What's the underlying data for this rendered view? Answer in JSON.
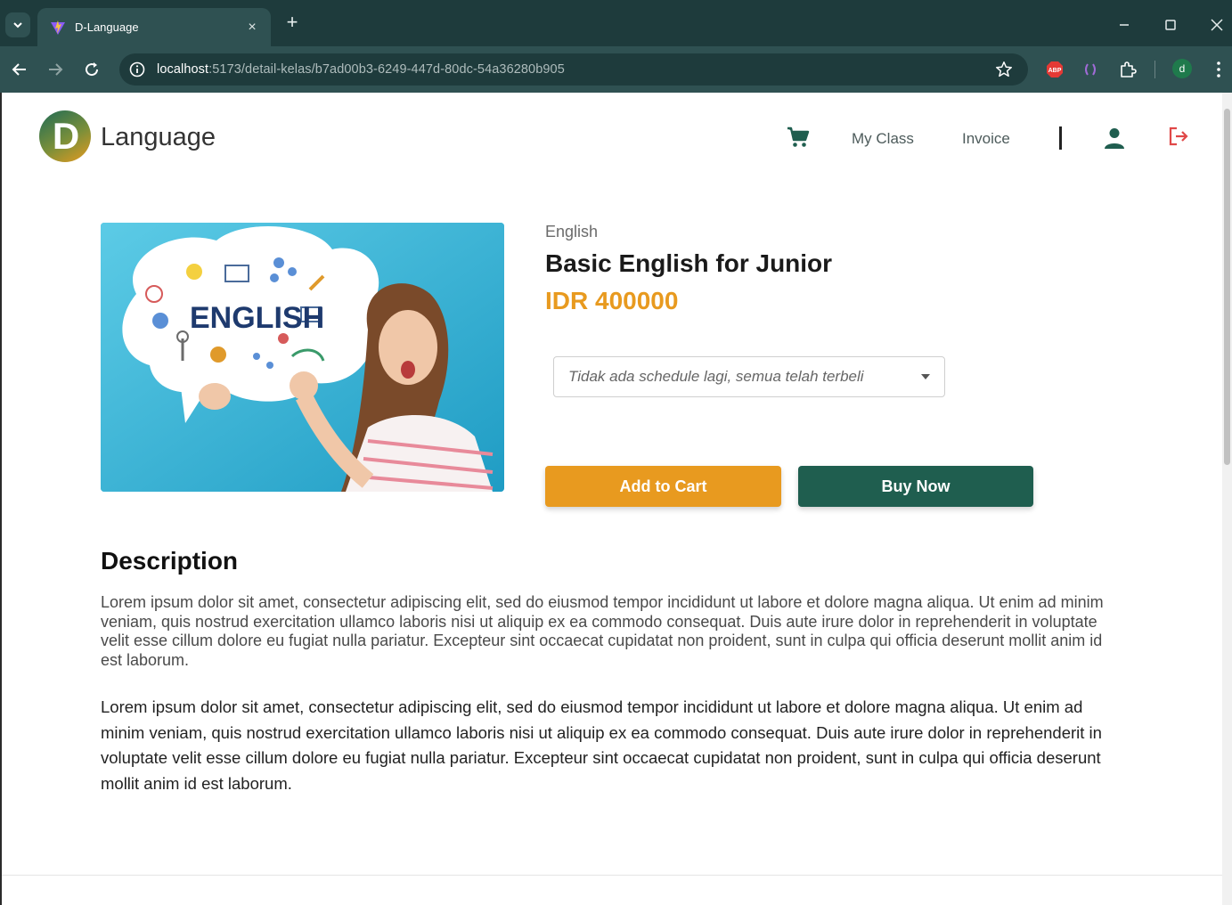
{
  "browser": {
    "tab_title": "D-Language",
    "tab_close": "×",
    "new_tab": "+",
    "url_host": "localhost",
    "url_path": ":5173/detail-kelas/b7ad00b3-6249-447d-80dc-54a36280b905",
    "profile_initial": "d",
    "extensions": [
      "adblock-icon",
      "bracket-extension-icon",
      "puzzle-icon"
    ]
  },
  "header": {
    "logo_letter": "D",
    "brand": "Language",
    "nav": {
      "my_class": "My Class",
      "invoice": "Invoice"
    }
  },
  "course": {
    "category": "English",
    "title": "Basic English for Junior",
    "price": "IDR 400000",
    "image_text": "ENGLISH",
    "schedule_select": "Tidak ada schedule lagi, semua telah terbeli",
    "add_to_cart": "Add to Cart",
    "buy_now": "Buy Now"
  },
  "description": {
    "heading": "Description",
    "paragraph1": "Lorem ipsum dolor sit amet, consectetur adipiscing elit, sed do eiusmod tempor incididunt ut labore et dolore magna aliqua. Ut enim ad minim veniam, quis nostrud exercitation ullamco laboris nisi ut aliquip ex ea commodo consequat. Duis aute irure dolor in reprehenderit in voluptate velit esse cillum dolore eu fugiat nulla pariatur. Excepteur sint occaecat cupidatat non proident, sunt in culpa qui officia deserunt mollit anim id est laborum.",
    "paragraph2": "Lorem ipsum dolor sit amet, consectetur adipiscing elit, sed do eiusmod tempor incididunt ut labore et dolore magna aliqua. Ut enim ad minim veniam, quis nostrud exercitation ullamco laboris nisi ut aliquip ex ea commodo consequat. Duis aute irure dolor in reprehenderit in voluptate velit esse cillum dolore eu fugiat nulla pariatur. Excepteur sint occaecat cupidatat non proident, sunt in culpa qui officia deserunt mollit anim id est laborum."
  },
  "colors": {
    "accent_orange": "#e89a1f",
    "accent_green": "#1f5e4f",
    "chrome_dark": "#1e3b3c",
    "chrome_toolbar": "#2f5152",
    "logout_red": "#e04848"
  }
}
